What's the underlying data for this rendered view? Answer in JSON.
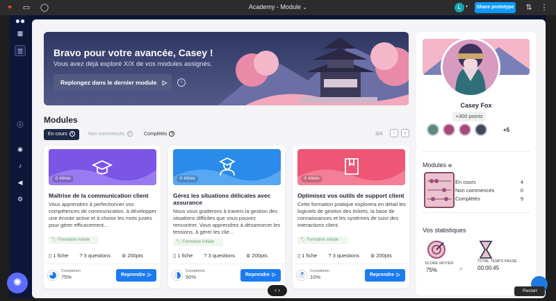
{
  "window": {
    "title": "Academy - Module",
    "caret": "⌄",
    "user_initial": "L",
    "share_label": "Share prototype"
  },
  "hero": {
    "title": "Bravo pour votre avancée, Casey !",
    "subtitle": "Vous avez déjà exploré X/X de vos modules assignés.",
    "cta": "Replongez dans le dernier module",
    "cta_icon": "▷",
    "info": "i"
  },
  "modules": {
    "title": "Modules",
    "tabs": [
      {
        "label": "En cours",
        "count": "4"
      },
      {
        "label": "Non commencés",
        "count": "0"
      },
      {
        "label": "Complétés",
        "count": "9"
      }
    ],
    "pager": "3/4",
    "prev": "‹",
    "next": "›"
  },
  "cards": [
    {
      "duration": "40min",
      "title": "Maîtrise de la communication client",
      "desc": "Vous apprendrez à perfectionner vos compétences de communication, à développer une écoute active et à choisir les mots justes pour gérer efficacement…",
      "tag": "Formation initiale",
      "files": "1 fiche",
      "questions": "3 questions",
      "points": "200pts",
      "completion_label": "Completion",
      "completion": "75%",
      "completion_value": 0.75,
      "button": "Reprendre",
      "arrow": "▷",
      "color": "#7b55e6"
    },
    {
      "duration": "40min",
      "title": "Gérez les situations délicates avec assurance",
      "desc": "Nous vous guiderons à travers la gestion des situations difficiles que vous pouvez rencontrer. Vous apprendrez à désamorcer les tensions, à gérer les clie…",
      "tag": "Formation initiale",
      "files": "1 fiche",
      "questions": "3 questions",
      "points": "200pts",
      "completion_label": "Completion",
      "completion": "50%",
      "completion_value": 0.5,
      "button": "Reprendre",
      "arrow": "▷",
      "color": "#2b8be8"
    },
    {
      "duration": "40min",
      "title": "Optimisez vos outils de support client",
      "desc": "Cette formation pratique explorera en détail les logiciels de gestion des tickets, la base de connaissances et les systèmes de suivi des interactions client.",
      "tag": "Formation initiale",
      "files": "1 fiche",
      "questions": "3 questions",
      "points": "200pts",
      "completion_label": "Completion",
      "completion": "10%",
      "completion_value": 0.1,
      "button": "Reprendre",
      "arrow": "▷",
      "color": "#ef5676"
    }
  ],
  "profile": {
    "name": "Casey Fox",
    "points": "+300 points",
    "more_badges": "+5",
    "badge_colors": [
      "#5d8a7a",
      "#a24a7a",
      "#a24a7a",
      "#3f4a5a"
    ]
  },
  "modules_summary": {
    "title": "Modules",
    "stats": [
      {
        "label": "En cours",
        "value": "4"
      },
      {
        "label": "Non commencés",
        "value": "0"
      },
      {
        "label": "Complétés",
        "value": "9"
      }
    ]
  },
  "stats": {
    "title": "Vos statistiques",
    "score_label": "SCORE  MOYEN",
    "score": "75%",
    "time_label": "TOTAL TEMPS PASSÉ",
    "time": "00:00:45"
  },
  "footer": {
    "reset": "Restart"
  }
}
